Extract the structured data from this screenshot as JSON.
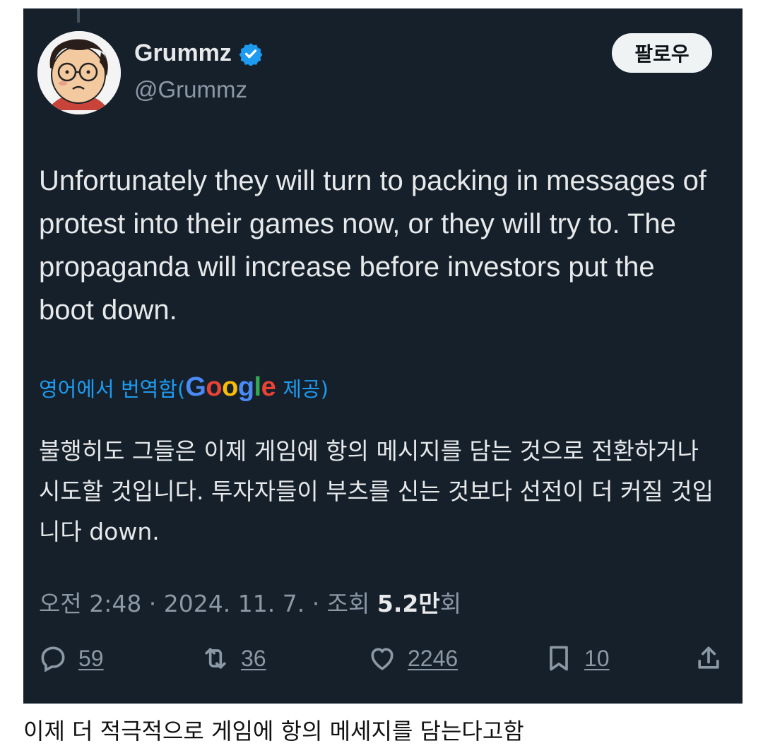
{
  "tweet": {
    "display_name": "Grummz",
    "handle": "@Grummz",
    "verified": true,
    "follow_label": "팔로우",
    "text": "Unfortunately they will turn to packing in messages of protest into their games now, or they will try to. The propaganda will increase before investors put the boot down.",
    "translation_prefix": "영어에서 번역함(",
    "translation_google": "Google",
    "translation_suffix": " 제공)",
    "translated_text": "불행히도 그들은 이제 게임에 항의 메시지를 담는 것으로 전환하거나 시도할 것입니다. 투자자들이 부츠를 신는 것보다 선전이 더 커질 것입니다 down.",
    "meta_prefix": "오전 2:48 · 2024. 11. 7. · 조회 ",
    "views": "5.2만",
    "views_suffix": "회",
    "stats": {
      "replies": "59",
      "retweets": "36",
      "likes": "2246",
      "bookmarks": "10"
    }
  },
  "icons": [
    "reply-icon",
    "retweet-icon",
    "like-icon",
    "bookmark-icon",
    "share-icon",
    "verified-badge-icon"
  ],
  "colors": {
    "background": "#15202b",
    "link": "#1d9bf0",
    "verified": "#1d9bf0",
    "text": "#e7e9ea",
    "muted": "#8b98a5"
  },
  "caption": "이제 더 적극적으로 게임에 항의 메세지를 담는다고함"
}
